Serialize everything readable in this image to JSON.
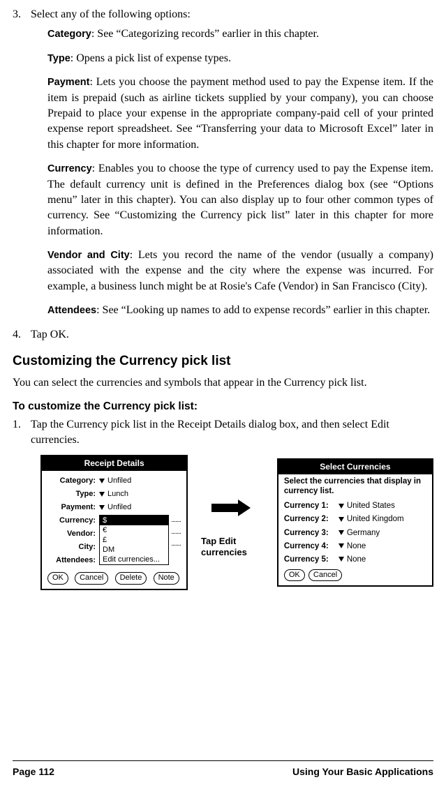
{
  "steps": {
    "s3_num": "3.",
    "s3_text": "Select any of the following options:",
    "s4_num": "4.",
    "s4_text": "Tap OK."
  },
  "defs": {
    "category": {
      "term": "Category",
      "text": ": See “Categorizing records” earlier in this chapter."
    },
    "type": {
      "term": "Type",
      "text": ": Opens a pick list of expense types."
    },
    "payment": {
      "term": "Payment",
      "text": ": Lets you choose the payment method used to pay the Expense item. If the item is prepaid (such as airline tickets supplied by your company), you can choose Prepaid to place your expense in the appropriate company-paid cell of your printed expense report spreadsheet. See “Transferring your data to Microsoft Excel” later in this chapter for more information."
    },
    "currency": {
      "term": "Currency",
      "text": ": Enables you to choose the type of currency used to pay the Expense item. The default currency unit is defined in the Preferences dialog box (see “Options menu”  later in this chapter). You can also display up to four other common types of currency. See “Customizing the Currency pick list” later in this chapter for more information."
    },
    "vendor": {
      "term": "Vendor and City",
      "text": ": Lets you record the name of the vendor (usually a company) associated with the expense and the city where the expense was incurred. For example, a business lunch might be at Rosie's Cafe (Vendor) in San Francisco (City)."
    },
    "attendees": {
      "term": "Attendees",
      "text": ": See “Looking up names to add to expense records” earlier in this chapter."
    }
  },
  "section_heading": "Customizing the Currency pick list",
  "section_text": "You can select the currencies and symbols that appear in the Currency pick list.",
  "subsection": "To customize the Currency pick list:",
  "step1_num": "1.",
  "step1_text": "Tap the Currency pick list in the Receipt Details dialog box, and then select Edit currencies.",
  "receipt": {
    "title": "Receipt Details",
    "category_label": "Category:",
    "category_val": "Unfiled",
    "type_label": "Type:",
    "type_val": "Lunch",
    "payment_label": "Payment:",
    "payment_val": "Unfiled",
    "currency_label": "Currency:",
    "vendor_label": "Vendor:",
    "city_label": "City:",
    "attendees_label": "Attendees:",
    "picklist": [
      "$",
      "€",
      "£",
      "DM",
      "Edit currencies..."
    ],
    "btn_ok": "OK",
    "btn_cancel": "Cancel",
    "btn_delete": "Delete",
    "btn_note": "Note"
  },
  "callout": "Tap Edit currencies",
  "select": {
    "title": "Select Currencies",
    "instr": "Select the currencies that display in currency list.",
    "rows": [
      {
        "label": "Currency 1:",
        "val": "United States"
      },
      {
        "label": "Currency 2:",
        "val": "United Kingdom"
      },
      {
        "label": "Currency 3:",
        "val": "Germany"
      },
      {
        "label": "Currency 4:",
        "val": "None"
      },
      {
        "label": "Currency 5:",
        "val": "None"
      }
    ],
    "btn_ok": "OK",
    "btn_cancel": "Cancel"
  },
  "footer": {
    "left": "Page 112",
    "right": "Using Your Basic Applications"
  }
}
